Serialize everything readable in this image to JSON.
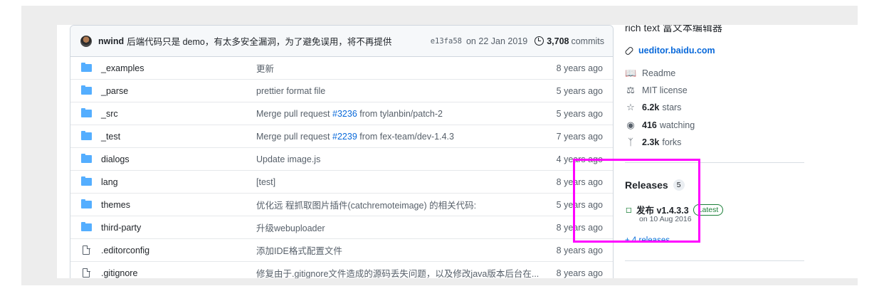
{
  "commit": {
    "author": "nwind",
    "message": "后端代码只是 demo，有太多安全漏洞，为了避免误用，将不再提供",
    "sha": "e13fa58",
    "date": "on 22 Jan 2019",
    "count": "3,708",
    "count_label": "commits"
  },
  "files": [
    {
      "type": "folder",
      "name": "_examples",
      "message": "更新",
      "age": "8 years ago"
    },
    {
      "type": "folder",
      "name": "_parse",
      "message": "prettier format file",
      "age": "5 years ago"
    },
    {
      "type": "folder",
      "name": "_src",
      "message_pre": "Merge pull request ",
      "message_link": "#3236",
      "message_post": " from tylanbin/patch-2",
      "age": "5 years ago"
    },
    {
      "type": "folder",
      "name": "_test",
      "message_pre": "Merge pull request ",
      "message_link": "#2239",
      "message_post": " from fex-team/dev-1.4.3",
      "age": "7 years ago"
    },
    {
      "type": "folder",
      "name": "dialogs",
      "message": "Update image.js",
      "age": "4 years ago"
    },
    {
      "type": "folder",
      "name": "lang",
      "message": "[test]",
      "age": "8 years ago"
    },
    {
      "type": "folder",
      "name": "themes",
      "message": "优化远 程抓取图片插件(catchremoteimage) 的相关代码:",
      "age": "5 years ago"
    },
    {
      "type": "folder",
      "name": "third-party",
      "message": "升级webuploader",
      "age": "8 years ago"
    },
    {
      "type": "file",
      "name": ".editorconfig",
      "message": "添加IDE格式配置文件",
      "age": "8 years ago"
    },
    {
      "type": "file",
      "name": ".gitignore",
      "message": "修复由于.gitignore文件造成的源码丢失问题，以及修改java版本后台在...",
      "age": "8 years ago"
    }
  ],
  "about": {
    "description": "rich text 富文本编辑器",
    "homepage": "ueditor.baidu.com",
    "readme": "Readme",
    "license": "MIT license",
    "stars_count": "6.2k",
    "stars_label": "stars",
    "watching_count": "416",
    "watching_label": "watching",
    "forks_count": "2.3k",
    "forks_label": "forks"
  },
  "releases": {
    "title": "Releases",
    "count": "5",
    "latest_name": "发布 v1.4.3.3",
    "latest_badge": "Latest",
    "latest_date": "on 10 Aug 2016",
    "more": "+ 4 releases"
  },
  "colors": {
    "highlight": "#ff00ff",
    "link": "#0969da",
    "folder": "#54aeff",
    "latest": "#1a7f37"
  }
}
